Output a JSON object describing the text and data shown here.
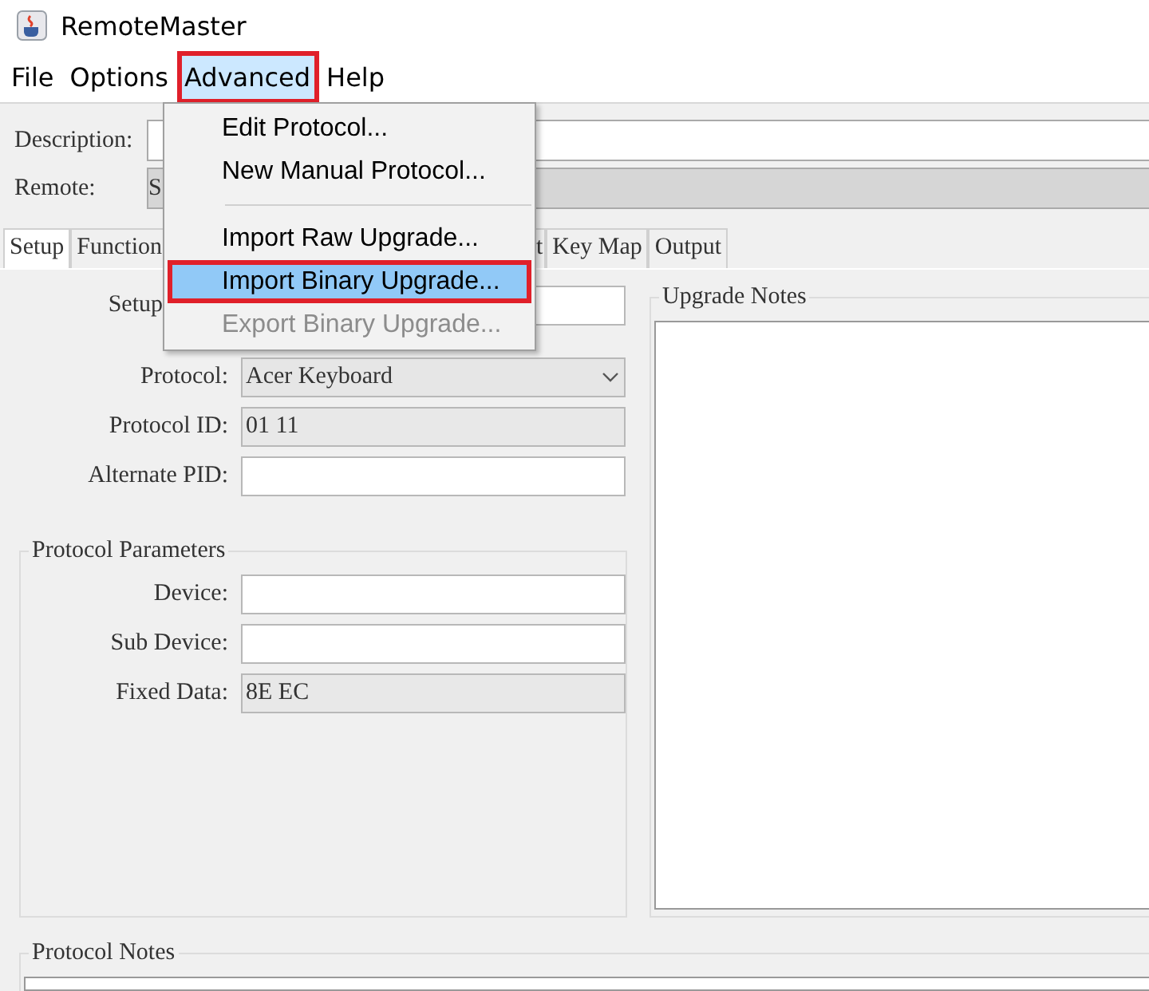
{
  "window": {
    "title": "RemoteMaster"
  },
  "menu_bar": [
    {
      "label": "File",
      "selected": false,
      "highlighted": false
    },
    {
      "label": "Options",
      "selected": false,
      "highlighted": false
    },
    {
      "label": "Advanced",
      "selected": true,
      "highlighted": true
    },
    {
      "label": "Help",
      "selected": false,
      "highlighted": false
    }
  ],
  "header_fields": [
    {
      "label": "Description:",
      "disabled": false
    },
    {
      "label": "Remote:",
      "value": "S",
      "disabled": true
    }
  ],
  "tabs": [
    {
      "label": "Setup",
      "selected": true
    },
    {
      "label": "Function",
      "selected": false
    },
    {
      "label": "t",
      "selected": false
    },
    {
      "label": "Key Map",
      "selected": false
    },
    {
      "label": "Output",
      "selected": false
    }
  ],
  "setup_fields": [
    {
      "label": "Setup",
      "kind": "text"
    },
    {
      "label": "Protocol:",
      "kind": "dropdown",
      "value": "Acer Keyboard"
    },
    {
      "label": "Protocol ID:",
      "kind": "readonly",
      "value": "01 11"
    },
    {
      "label": "Alternate PID:",
      "kind": "text"
    }
  ],
  "protocol_parameters": {
    "title": "Protocol Parameters",
    "fields": [
      {
        "label": "Device:",
        "kind": "text"
      },
      {
        "label": "Sub Device:",
        "kind": "text"
      },
      {
        "label": "Fixed Data:",
        "kind": "readonly",
        "value": "8E EC"
      }
    ]
  },
  "upgrade_notes": {
    "title": "Upgrade Notes"
  },
  "protocol_notes": {
    "title": "Protocol Notes"
  },
  "dropdown_menu": [
    {
      "kind": "item",
      "label": "Edit Protocol...",
      "disabled": false,
      "selected": false,
      "highlighted": false
    },
    {
      "kind": "item",
      "label": "New Manual Protocol...",
      "disabled": false,
      "selected": false,
      "highlighted": false
    },
    {
      "kind": "separator"
    },
    {
      "kind": "item",
      "label": "Import Raw Upgrade...",
      "disabled": false,
      "selected": false,
      "highlighted": false
    },
    {
      "kind": "item",
      "label": "Import Binary Upgrade...",
      "disabled": false,
      "selected": true,
      "highlighted": true
    },
    {
      "kind": "item",
      "label": "Export Binary Upgrade...",
      "disabled": true,
      "selected": false,
      "highlighted": false
    }
  ]
}
